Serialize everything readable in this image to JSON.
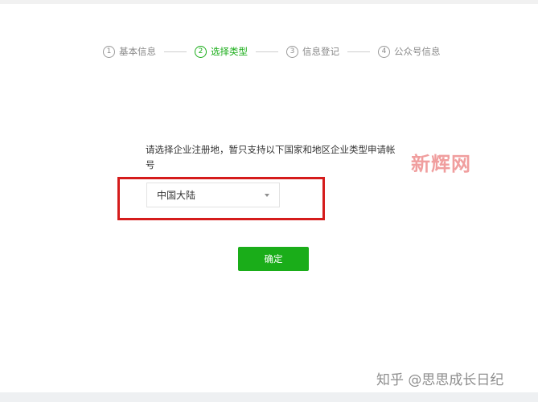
{
  "steps": [
    {
      "num": "1",
      "label": "基本信息",
      "state": "done"
    },
    {
      "num": "2",
      "label": "选择类型",
      "state": "active"
    },
    {
      "num": "3",
      "label": "信息登记",
      "state": "pending"
    },
    {
      "num": "4",
      "label": "公众号信息",
      "state": "pending"
    }
  ],
  "form": {
    "prompt": "请选择企业注册地，暂只支持以下国家和地区企业类型申请帐号",
    "region_select": {
      "value": "中国大陆"
    },
    "confirm_label": "确定"
  },
  "watermarks": {
    "site": "新辉网",
    "zhihu": "知乎 @思思成长日纪"
  },
  "colors": {
    "accent": "#1aad19",
    "highlight": "#d51c1c"
  }
}
